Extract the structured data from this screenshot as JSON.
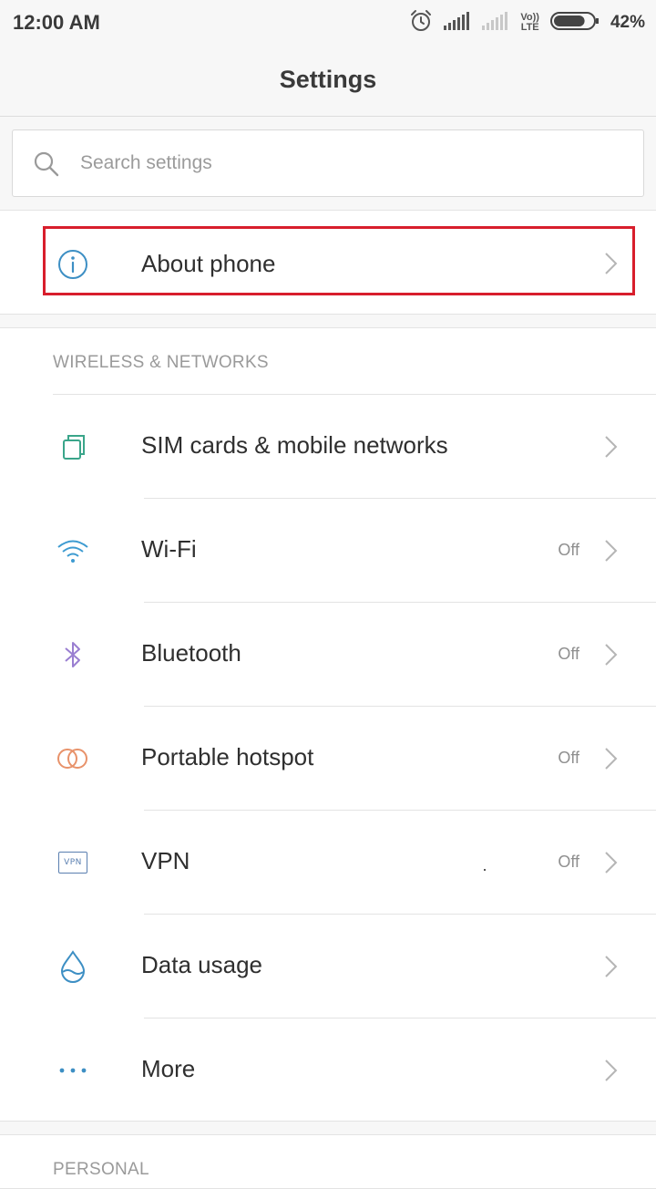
{
  "status_bar": {
    "time": "12:00 AM",
    "volte_top": "Vo))",
    "volte_bottom": "LTE",
    "battery_percent": "42%",
    "battery_level": 0.42,
    "icons": [
      "alarm-icon",
      "signal-icon",
      "signal-weak-icon",
      "volte-icon",
      "battery-icon"
    ]
  },
  "app_bar": {
    "title": "Settings"
  },
  "search": {
    "placeholder": "Search settings",
    "value": ""
  },
  "about": {
    "label": "About phone",
    "icon": "info-icon",
    "highlight_color": "#d81e2c"
  },
  "wireless": {
    "header": "WIRELESS & NETWORKS",
    "items": [
      {
        "label": "SIM cards & mobile networks",
        "status": "",
        "icon": "sim-card-icon"
      },
      {
        "label": "Wi-Fi",
        "status": "Off",
        "icon": "wifi-icon"
      },
      {
        "label": "Bluetooth",
        "status": "Off",
        "icon": "bluetooth-icon"
      },
      {
        "label": "Portable hotspot",
        "status": "Off",
        "icon": "hotspot-icon"
      },
      {
        "label": "VPN",
        "status": "Off",
        "icon": "vpn-icon",
        "badge": "VPN"
      },
      {
        "label": "Data usage",
        "status": "",
        "icon": "data-usage-icon"
      },
      {
        "label": "More",
        "status": "",
        "icon": "more-icon"
      }
    ]
  },
  "personal": {
    "header": "PERSONAL"
  },
  "colors": {
    "background": "#f7f7f7",
    "card": "#ffffff",
    "accent_blue": "#3d8fc4",
    "highlight_red": "#d81e2c"
  }
}
